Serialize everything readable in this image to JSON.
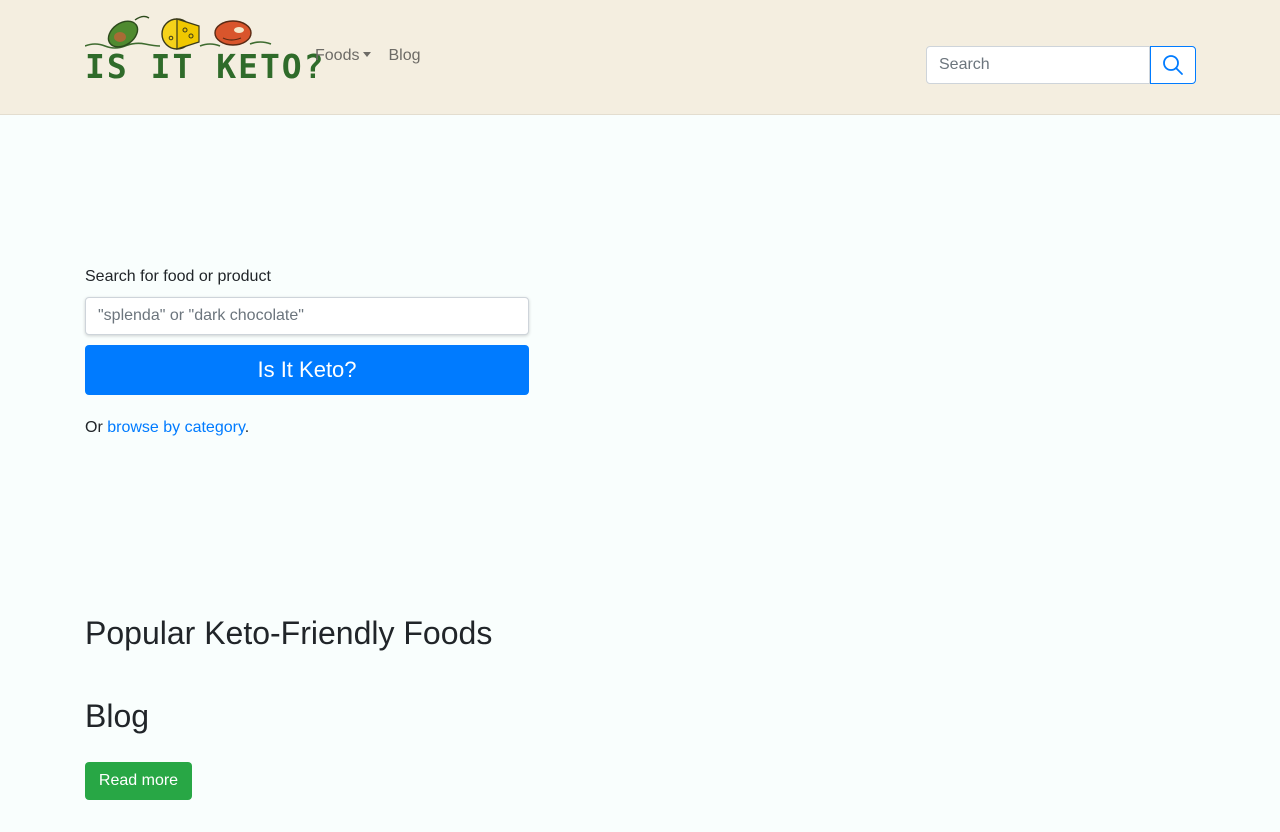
{
  "header": {
    "logo_text": "IS IT KETO?",
    "nav": {
      "foods_label": "Foods",
      "blog_label": "Blog"
    },
    "search": {
      "placeholder": "Search"
    }
  },
  "main": {
    "search_label": "Search for food or product",
    "search_placeholder": "\"splenda\" or \"dark chocolate\"",
    "submit_label": "Is It Keto?",
    "browse_prefix": "Or ",
    "browse_link": "browse by category",
    "browse_suffix": "."
  },
  "sections": {
    "popular_heading": "Popular Keto-Friendly Foods",
    "blog_heading": "Blog",
    "read_more_label": "Read more"
  },
  "colors": {
    "header_bg": "#f4eee0",
    "primary": "#007bff",
    "success": "#28a745",
    "logo_green": "#2f6b2a"
  },
  "icons": [
    "avocado-icon",
    "cheese-icon",
    "steak-icon",
    "search-icon",
    "caret-down-icon"
  ]
}
